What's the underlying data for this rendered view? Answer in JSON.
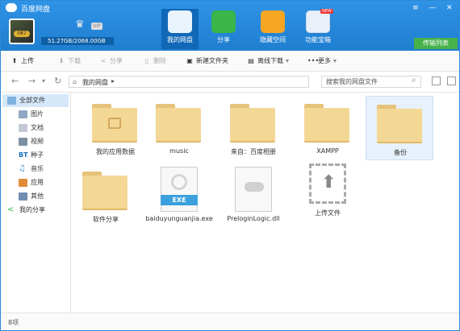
{
  "app": {
    "title": "百度网盘",
    "storage": "51.27GB/2068.00GB",
    "vip": "VIP",
    "avatar_text": "087"
  },
  "nav": [
    {
      "label": "我的网盘"
    },
    {
      "label": "分享"
    },
    {
      "label": "隐藏空间"
    },
    {
      "label": "功能宝箱",
      "badge": "NEW"
    }
  ],
  "window": {
    "menu": "≡",
    "minimize": "—",
    "close": "✕"
  },
  "transfer_label": "传输列表",
  "toolbar": {
    "upload": "上传",
    "download": "下载",
    "share": "分享",
    "delete": "删除",
    "new_folder": "新建文件夹",
    "offline": "离线下载",
    "more": "更多"
  },
  "address": {
    "path": "我的网盘",
    "search_placeholder": "搜索我的网盘文件"
  },
  "sidebar": [
    {
      "label": "全部文件"
    },
    {
      "label": "图片"
    },
    {
      "label": "文档"
    },
    {
      "label": "视频"
    },
    {
      "label": "种子"
    },
    {
      "label": "音乐"
    },
    {
      "label": "应用"
    },
    {
      "label": "其他"
    },
    {
      "label": "我的分享"
    }
  ],
  "files": [
    {
      "name": "我的应用数据"
    },
    {
      "name": "music"
    },
    {
      "name": "来自：百度相册"
    },
    {
      "name": "XAMPP"
    },
    {
      "name": "备份"
    },
    {
      "name": "软件分享"
    },
    {
      "name": "baiduyunguanjia.exe",
      "badge": "EXE"
    },
    {
      "name": "PreloginLogic.dll"
    },
    {
      "name": "上传文件"
    }
  ],
  "status": {
    "count": "8项"
  },
  "colors": {
    "header": "#2f93e6",
    "folder": "#f3d795",
    "transfer": "#47b14a",
    "exe": "#3ba0dc"
  }
}
